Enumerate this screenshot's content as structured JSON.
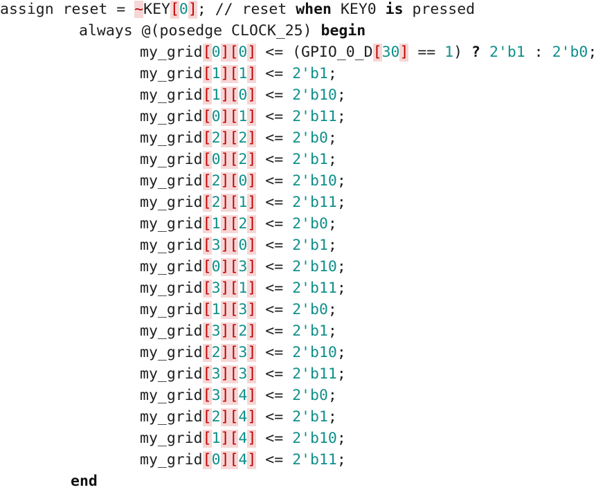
{
  "code_lines": [
    {
      "indent": 0,
      "tokens": [
        {
          "t": "assign reset = ",
          "c": ""
        },
        {
          "t": "~",
          "c": "tok-tilde"
        },
        {
          "t": "KEY",
          "c": ""
        },
        {
          "t": "[",
          "c": "tok-br"
        },
        {
          "t": "0",
          "c": "tok-num"
        },
        {
          "t": "]",
          "c": "tok-br"
        },
        {
          "t": "; // reset ",
          "c": ""
        },
        {
          "t": "when",
          "c": "tok-kw"
        },
        {
          "t": " KEY0 ",
          "c": ""
        },
        {
          "t": "is",
          "c": "tok-kw"
        },
        {
          "t": " pressed",
          "c": ""
        }
      ]
    },
    {
      "indent": 1,
      "tokens": [
        {
          "t": "always @(posedge CLOCK_25) ",
          "c": ""
        },
        {
          "t": "begin",
          "c": "tok-kw"
        }
      ]
    },
    {
      "indent": 2,
      "tokens": [
        {
          "t": "my_grid",
          "c": ""
        },
        {
          "t": "[",
          "c": "tok-br"
        },
        {
          "t": "0",
          "c": "tok-num"
        },
        {
          "t": "]",
          "c": "tok-br"
        },
        {
          "t": "[",
          "c": "tok-br"
        },
        {
          "t": "0",
          "c": "tok-num"
        },
        {
          "t": "]",
          "c": "tok-br"
        },
        {
          "t": " <= (GPIO_0_D",
          "c": ""
        },
        {
          "t": "[",
          "c": "tok-br"
        },
        {
          "t": "30",
          "c": "tok-num"
        },
        {
          "t": "]",
          "c": "tok-br"
        },
        {
          "t": " == ",
          "c": ""
        },
        {
          "t": "1",
          "c": "tok-num"
        },
        {
          "t": ") ",
          "c": ""
        },
        {
          "t": "?",
          "c": "tok-op"
        },
        {
          "t": " ",
          "c": ""
        },
        {
          "t": "2'b1",
          "c": "tok-num"
        },
        {
          "t": " : ",
          "c": ""
        },
        {
          "t": "2'b0",
          "c": "tok-num"
        },
        {
          "t": ";",
          "c": ""
        }
      ]
    },
    {
      "indent": 2,
      "grid": [
        "1",
        "1"
      ],
      "value": "2'b1"
    },
    {
      "indent": 2,
      "grid": [
        "1",
        "0"
      ],
      "value": "2'b10"
    },
    {
      "indent": 2,
      "grid": [
        "0",
        "1"
      ],
      "value": "2'b11"
    },
    {
      "indent": 2,
      "grid": [
        "2",
        "2"
      ],
      "value": "2'b0"
    },
    {
      "indent": 2,
      "grid": [
        "0",
        "2"
      ],
      "value": "2'b1"
    },
    {
      "indent": 2,
      "grid": [
        "2",
        "0"
      ],
      "value": "2'b10"
    },
    {
      "indent": 2,
      "grid": [
        "2",
        "1"
      ],
      "value": "2'b11"
    },
    {
      "indent": 2,
      "grid": [
        "1",
        "2"
      ],
      "value": "2'b0"
    },
    {
      "indent": 2,
      "grid": [
        "3",
        "0"
      ],
      "value": "2'b1"
    },
    {
      "indent": 2,
      "grid": [
        "0",
        "3"
      ],
      "value": "2'b10"
    },
    {
      "indent": 2,
      "grid": [
        "3",
        "1"
      ],
      "value": "2'b11"
    },
    {
      "indent": 2,
      "grid": [
        "1",
        "3"
      ],
      "value": "2'b0"
    },
    {
      "indent": 2,
      "grid": [
        "3",
        "2"
      ],
      "value": "2'b1"
    },
    {
      "indent": 2,
      "grid": [
        "2",
        "3"
      ],
      "value": "2'b10"
    },
    {
      "indent": 2,
      "grid": [
        "3",
        "3"
      ],
      "value": "2'b11"
    },
    {
      "indent": 2,
      "grid": [
        "3",
        "4"
      ],
      "value": "2'b0"
    },
    {
      "indent": 2,
      "grid": [
        "2",
        "4"
      ],
      "value": "2'b1"
    },
    {
      "indent": 2,
      "grid": [
        "1",
        "4"
      ],
      "value": "2'b10"
    },
    {
      "indent": 2,
      "grid": [
        "0",
        "4"
      ],
      "value": "2'b11"
    },
    {
      "indent": 3,
      "tokens": [
        {
          "t": "end",
          "c": "tok-kw"
        }
      ]
    }
  ],
  "colors": {
    "number": "#0f8f8a",
    "bracket": "#c00000",
    "bracket_bg": "#f6d6d6",
    "text": "#1e1e1e"
  }
}
